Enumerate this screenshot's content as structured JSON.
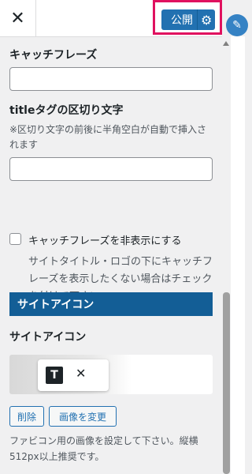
{
  "header": {
    "close_glyph": "✕",
    "publish_label": "公開",
    "gear_glyph": "⚙",
    "edit_glyph": "✎"
  },
  "fields": {
    "catchphrase_label": "キャッチフレーズ",
    "catchphrase_value": "",
    "title_sep_label": "titleタグの区切り文字",
    "title_sep_desc": "※区切り文字の前後に半角空白が自動で挿入されます",
    "title_sep_value": "",
    "hide_catch_label": "キャッチフレーズを非表示にする",
    "hide_catch_desc": "サイトタイトル・ロゴの下にキャッチフレーズを表示したくない場合はチェックを付けて下さい"
  },
  "site_icon": {
    "section_title": "サイトアイコン",
    "label": "サイトアイコン",
    "tile_letter": "T",
    "remove_glyph": "✕",
    "remove_button": "削除",
    "change_button": "画像を変更",
    "note": "ファビコン用の画像を設定して下さい。縦横512px以上推奨です。"
  },
  "colors": {
    "accent": "#2271b1",
    "section_bar": "#135e96",
    "highlight": "#e0115f"
  }
}
